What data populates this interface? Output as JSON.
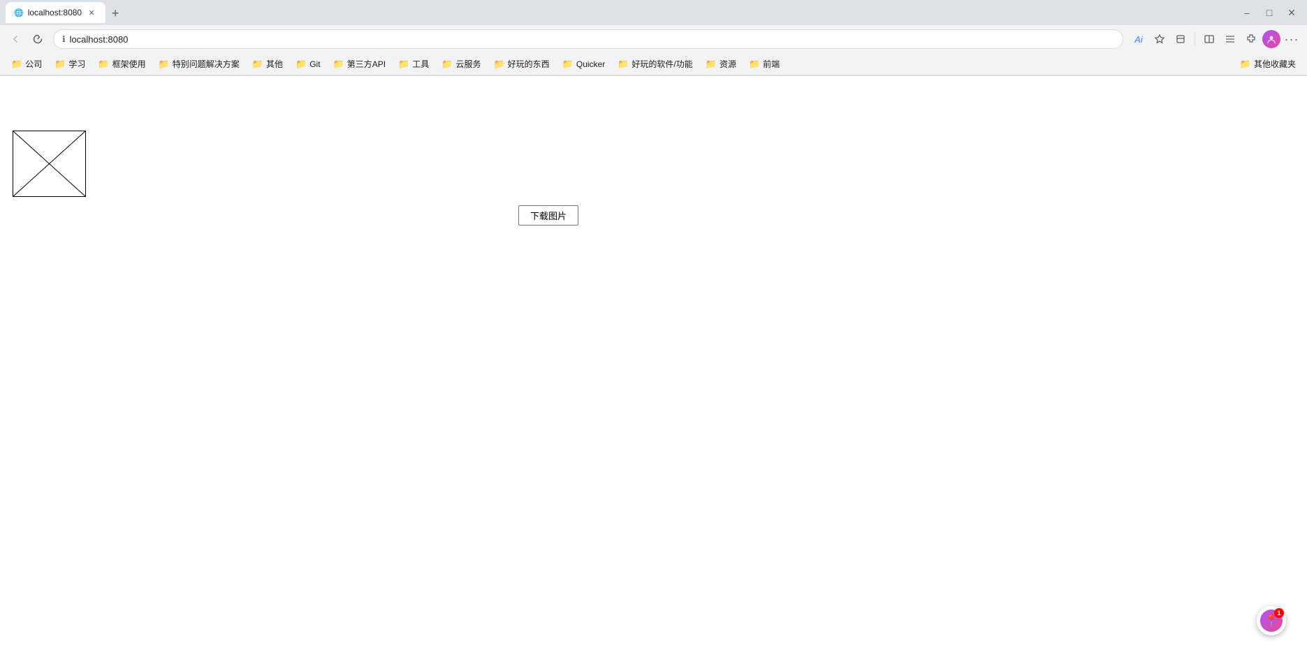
{
  "browser": {
    "tab": {
      "title": "localhost:8080",
      "favicon": "🌐"
    },
    "address": "localhost:8080",
    "ai_label": "Ai"
  },
  "bookmarks": [
    {
      "label": "公司",
      "type": "folder"
    },
    {
      "label": "学习",
      "type": "folder"
    },
    {
      "label": "框架使用",
      "type": "folder"
    },
    {
      "label": "特别问题解决方案",
      "type": "folder"
    },
    {
      "label": "其他",
      "type": "folder"
    },
    {
      "label": "Git",
      "type": "folder"
    },
    {
      "label": "第三方API",
      "type": "folder"
    },
    {
      "label": "工具",
      "type": "folder"
    },
    {
      "label": "云服务",
      "type": "folder"
    },
    {
      "label": "好玩的东西",
      "type": "folder"
    },
    {
      "label": "Quicker",
      "type": "folder"
    },
    {
      "label": "好玩的软件/功能",
      "type": "folder"
    },
    {
      "label": "资源",
      "type": "folder"
    },
    {
      "label": "前端",
      "type": "folder"
    },
    {
      "label": "其他收藏夹",
      "type": "folder"
    }
  ],
  "page": {
    "download_button_label": "下载图片"
  },
  "notification": {
    "badge_count": "1"
  }
}
